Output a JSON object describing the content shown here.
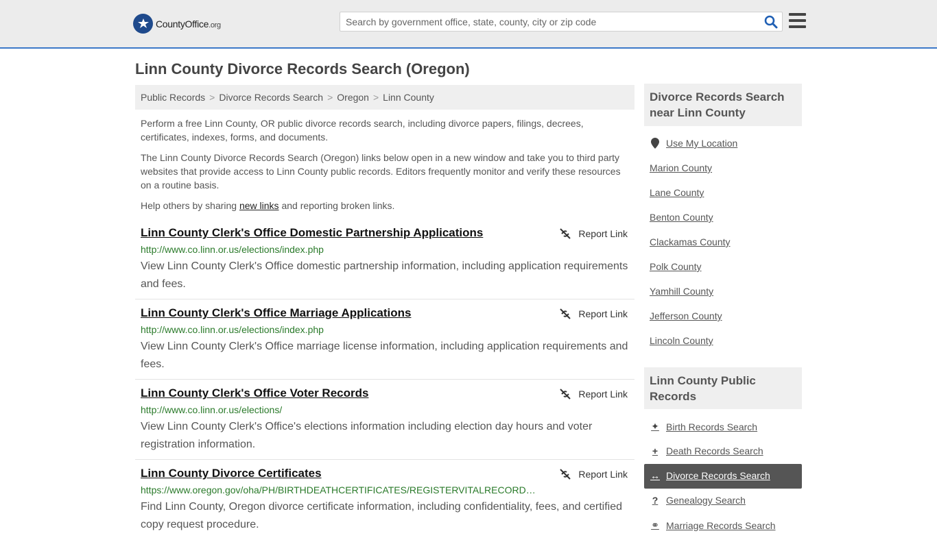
{
  "header": {
    "logo_text_main": "CountyOffice",
    "logo_text_tld": ".org",
    "search_placeholder": "Search by government office, state, county, city or zip code",
    "search_value": ""
  },
  "page_title": "Linn County Divorce Records Search (Oregon)",
  "breadcrumb": [
    "Public Records",
    "Divorce Records Search",
    "Oregon",
    "Linn County"
  ],
  "intro": {
    "p1": "Perform a free Linn County, OR public divorce records search, including divorce papers, filings, decrees, certificates, indexes, forms, and documents.",
    "p2": "The Linn County Divorce Records Search (Oregon) links below open in a new window and take you to third party websites that provide access to Linn County public records. Editors frequently monitor and verify these resources on a routine basis.",
    "p3_before": "Help others by sharing ",
    "p3_link": "new links",
    "p3_after": " and reporting broken links."
  },
  "report_label": "Report Link",
  "results": [
    {
      "title": "Linn County Clerk's Office Domestic Partnership Applications",
      "url": "http://www.co.linn.or.us/elections/index.php",
      "desc": "View Linn County Clerk's Office domestic partnership information, including application requirements and fees."
    },
    {
      "title": "Linn County Clerk's Office Marriage Applications",
      "url": "http://www.co.linn.or.us/elections/index.php",
      "desc": "View Linn County Clerk's Office marriage license information, including application requirements and fees."
    },
    {
      "title": "Linn County Clerk's Office Voter Records",
      "url": "http://www.co.linn.or.us/elections/",
      "desc": "View Linn County Clerk's Office's elections information including election day hours and voter registration information."
    },
    {
      "title": "Linn County Divorce Certificates",
      "url": "https://www.oregon.gov/oha/PH/BIRTHDEATHCERTIFICATES/REGISTERVITALRECORD…",
      "desc": "Find Linn County, Oregon divorce certificate information, including confidentiality, fees, and certified copy request procedure."
    }
  ],
  "sidebar": {
    "nearby_title": "Divorce Records Search near Linn County",
    "use_location": "Use My Location",
    "nearby": [
      "Marion County",
      "Lane County",
      "Benton County",
      "Clackamas County",
      "Polk County",
      "Yamhill County",
      "Jefferson County",
      "Lincoln County"
    ],
    "records_title": "Linn County Public Records",
    "records": [
      {
        "label": "Birth Records Search",
        "icon": "child-icon",
        "glyph": "✦"
      },
      {
        "label": "Death Records Search",
        "icon": "plus-icon",
        "glyph": "+"
      },
      {
        "label": "Divorce Records Search",
        "icon": "arrows-horizontal-icon",
        "glyph": "↔",
        "active": true
      },
      {
        "label": "Genealogy Search",
        "icon": "question-icon",
        "glyph": "?"
      },
      {
        "label": "Marriage Records Search",
        "icon": "rings-icon",
        "glyph": "⚭"
      }
    ]
  },
  "colors": {
    "header_bg": "#ececec",
    "header_border": "#3c78c8",
    "search_icon": "#1f5fb4",
    "url_green": "#2a7a2a",
    "active_bg": "#555555"
  }
}
